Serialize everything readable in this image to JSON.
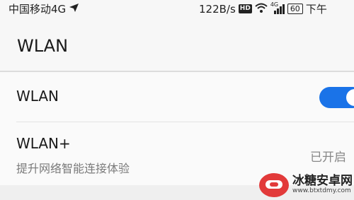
{
  "status_bar": {
    "carrier": "中国移动4G",
    "network_speed": "122B/s",
    "hd_badge": "HD",
    "signal_label": "4G",
    "battery": "60",
    "time": "下午"
  },
  "header": {
    "title": "WLAN"
  },
  "settings": {
    "wlan": {
      "label": "WLAN",
      "enabled": true
    },
    "wlan_plus": {
      "label": "WLAN+",
      "description": "提升网络智能连接体验",
      "status": "已开启"
    }
  },
  "colors": {
    "accent": "#1a73e8",
    "watermark": "#e23a3a"
  },
  "watermark": {
    "title": "冰糖安卓网",
    "url": "www.btxtdmy.com"
  }
}
